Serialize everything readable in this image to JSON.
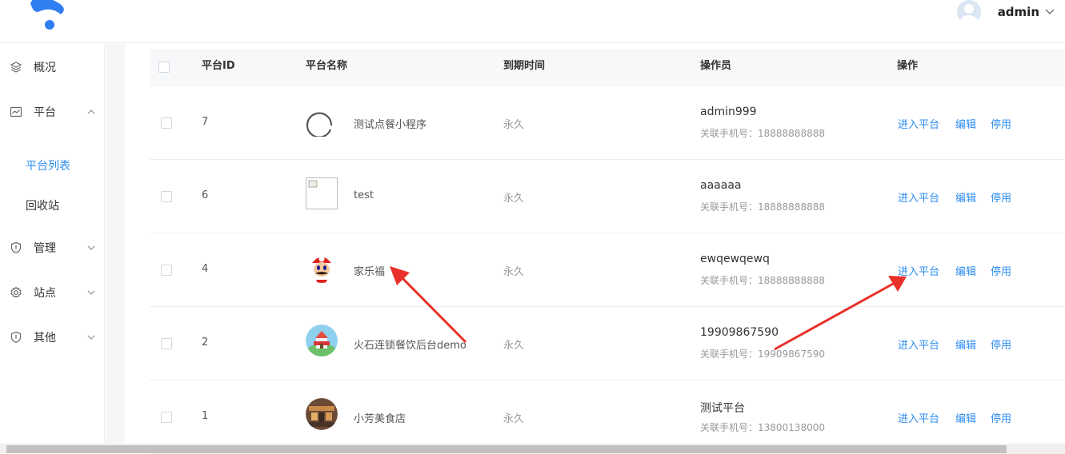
{
  "header": {
    "username": "admin"
  },
  "sidebar": {
    "items": [
      {
        "label": "概况",
        "icon": "layers-icon"
      },
      {
        "label": "平台",
        "icon": "chart-icon"
      },
      {
        "label": "管理",
        "icon": "shield-icon"
      },
      {
        "label": "站点",
        "icon": "gear-icon"
      },
      {
        "label": "其他",
        "icon": "shield-icon"
      }
    ],
    "sub_items": [
      {
        "label": "平台列表",
        "active": true
      },
      {
        "label": "回收站",
        "active": false
      }
    ]
  },
  "table": {
    "columns": [
      "平台ID",
      "平台名称",
      "到期时间",
      "操作员",
      "操作"
    ],
    "rows": [
      {
        "id": "7",
        "name": "测试点餐小程序",
        "expire": "永久",
        "operator": "admin999",
        "phone": "关联手机号：18888888888",
        "thumb": "loading-circle"
      },
      {
        "id": "6",
        "name": "test",
        "expire": "永久",
        "operator": "aaaaaa",
        "phone": "关联手机号：18888888888",
        "thumb": "broken-image"
      },
      {
        "id": "4",
        "name": "家乐福",
        "expire": "永久",
        "operator": "ewqewqewq",
        "phone": "关联手机号：18888888888",
        "thumb": "mario-avatar"
      },
      {
        "id": "2",
        "name": "火石连锁餐饮后台demo",
        "expire": "永久",
        "operator": "19909867590",
        "phone": "关联手机号：19909867590",
        "thumb": "castle-avatar"
      },
      {
        "id": "1",
        "name": "小芳美食店",
        "expire": "永久",
        "operator": "测试平台",
        "phone": "关联手机号：13800138000",
        "thumb": "shop-avatar"
      }
    ],
    "actions": {
      "enter": "进入平台",
      "edit": "编辑",
      "disable": "停用"
    }
  },
  "colors": {
    "accent": "#2d8cf0",
    "annotation_arrow": "#e8312a"
  }
}
